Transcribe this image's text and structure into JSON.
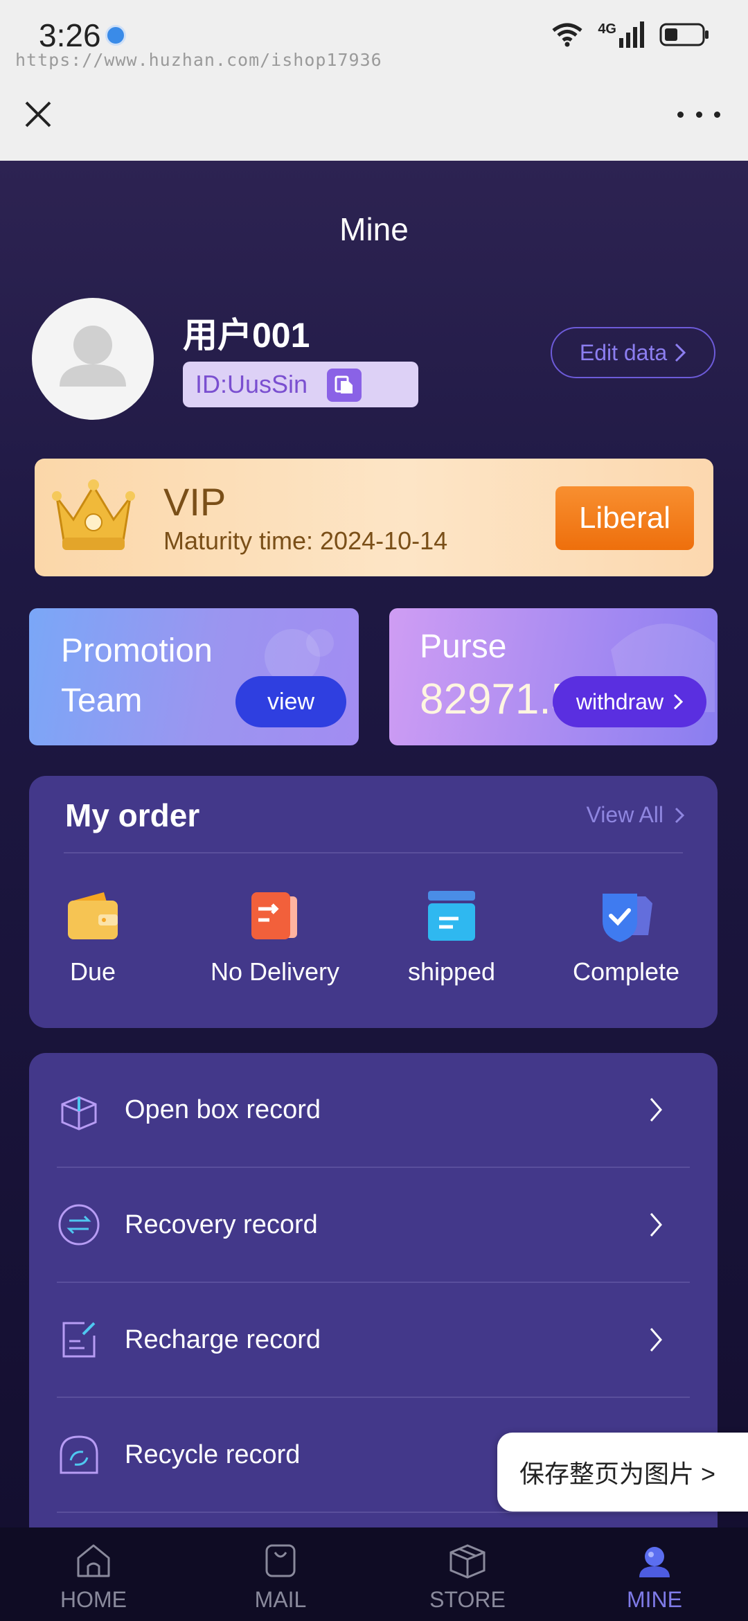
{
  "status_bar": {
    "time": "3:26",
    "network": "4G"
  },
  "watermark": "https://www.huzhan.com/ishop17936",
  "page": {
    "title": "Mine"
  },
  "profile": {
    "username": "用户001",
    "id_text": "ID:UusSin",
    "edit_label": "Edit data"
  },
  "vip": {
    "title": "VIP",
    "maturity": "Maturity time: 2024-10-14",
    "action_label": "Liberal"
  },
  "promotion": {
    "label": "Promotion Team",
    "action_label": "view"
  },
  "purse": {
    "label": "Purse",
    "amount": "82971.5",
    "action_label": "withdraw"
  },
  "orders": {
    "title": "My order",
    "view_all": "View All",
    "items": [
      {
        "label": "Due",
        "icon": "wallet-icon"
      },
      {
        "label": "No Delivery",
        "icon": "package-out-icon"
      },
      {
        "label": "shipped",
        "icon": "box-icon"
      },
      {
        "label": "Complete",
        "icon": "shield-check-icon"
      }
    ]
  },
  "records": [
    {
      "label": "Open box record",
      "icon": "open-box-icon"
    },
    {
      "label": "Recovery record",
      "icon": "exchange-icon"
    },
    {
      "label": "Recharge record",
      "icon": "edit-note-icon"
    },
    {
      "label": "Recycle record",
      "icon": "recycle-icon"
    }
  ],
  "save_popup": "保存整页为图片 >",
  "tabs": [
    {
      "label": "HOME",
      "icon": "home-icon",
      "active": false
    },
    {
      "label": "MAIL",
      "icon": "bag-icon",
      "active": false
    },
    {
      "label": "STORE",
      "icon": "cube-icon",
      "active": false
    },
    {
      "label": "MINE",
      "icon": "user-icon",
      "active": true
    }
  ],
  "colors": {
    "page_bg": "#1e1843",
    "card_bg": "#43388a",
    "accent": "#7f7be8",
    "liberal_button": "#f07a15",
    "vip_card": "#fde0bd"
  }
}
